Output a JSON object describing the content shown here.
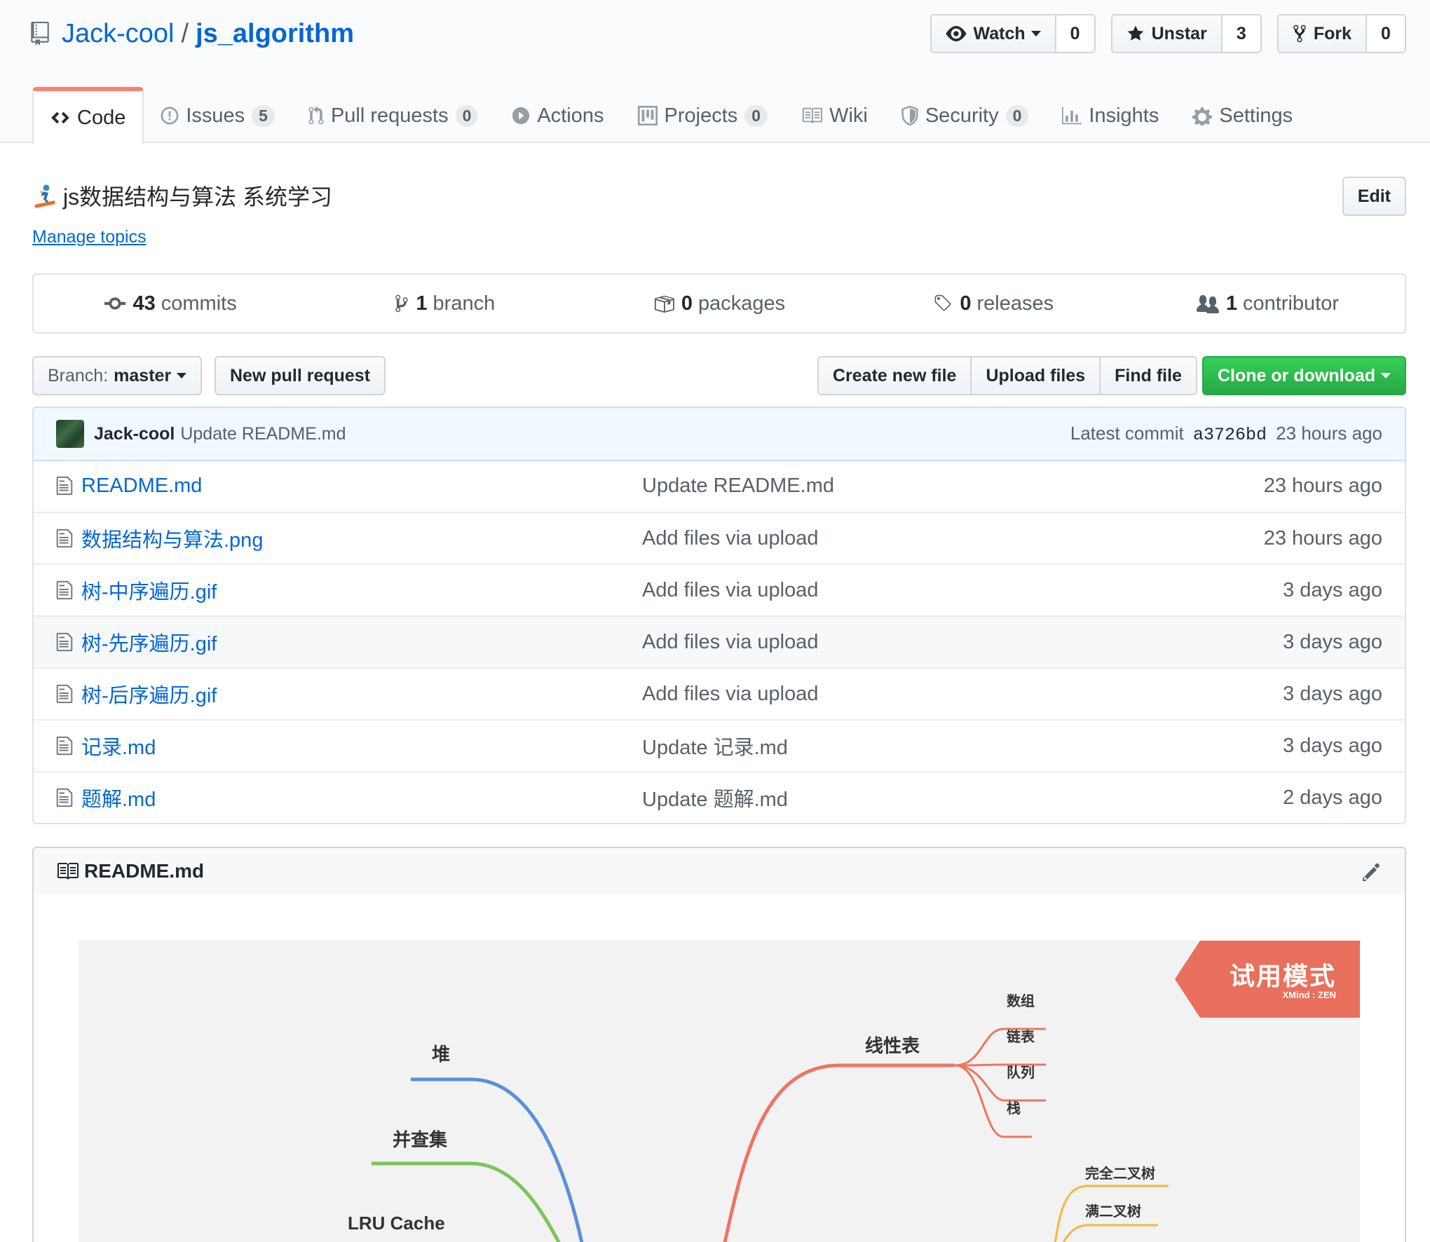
{
  "header": {
    "owner": "Jack-cool",
    "separator": "/",
    "repo": "js_algorithm",
    "watch": {
      "label": "Watch",
      "count": "0"
    },
    "star": {
      "label": "Unstar",
      "count": "3"
    },
    "fork": {
      "label": "Fork",
      "count": "0"
    }
  },
  "tabs": [
    {
      "label": "Code",
      "counter": ""
    },
    {
      "label": "Issues",
      "counter": "5"
    },
    {
      "label": "Pull requests",
      "counter": "0"
    },
    {
      "label": "Actions",
      "counter": ""
    },
    {
      "label": "Projects",
      "counter": "0"
    },
    {
      "label": "Wiki",
      "counter": ""
    },
    {
      "label": "Security",
      "counter": "0"
    },
    {
      "label": "Insights",
      "counter": ""
    },
    {
      "label": "Settings",
      "counter": ""
    }
  ],
  "description": {
    "text": "js数据结构与算法 系统学习",
    "manage_topics": "Manage topics",
    "edit": "Edit"
  },
  "summary": {
    "commits": {
      "count": "43",
      "label": "commits"
    },
    "branch": {
      "count": "1",
      "label": "branch"
    },
    "packages": {
      "count": "0",
      "label": "packages"
    },
    "releases": {
      "count": "0",
      "label": "releases"
    },
    "contributors": {
      "count": "1",
      "label": "contributor"
    }
  },
  "filenav": {
    "branch_prefix": "Branch:",
    "branch": "master",
    "new_pr": "New pull request",
    "create_file": "Create new file",
    "upload_files": "Upload files",
    "find_file": "Find file",
    "clone": "Clone or download"
  },
  "latest_commit": {
    "author": "Jack-cool",
    "message": "Update README.md",
    "prefix": "Latest commit",
    "sha": "a3726bd",
    "age": "23 hours ago"
  },
  "files": [
    {
      "name": "README.md",
      "message": "Update README.md",
      "age": "23 hours ago"
    },
    {
      "name": "数据结构与算法.png",
      "message": "Add files via upload",
      "age": "23 hours ago"
    },
    {
      "name": "树-中序遍历.gif",
      "message": "Add files via upload",
      "age": "3 days ago"
    },
    {
      "name": "树-先序遍历.gif",
      "message": "Add files via upload",
      "age": "3 days ago"
    },
    {
      "name": "树-后序遍历.gif",
      "message": "Add files via upload",
      "age": "3 days ago"
    },
    {
      "name": "记录.md",
      "message": "Update 记录.md",
      "age": "3 days ago"
    },
    {
      "name": "题解.md",
      "message": "Update 题解.md",
      "age": "2 days ago"
    }
  ],
  "readme": {
    "title": "README.md",
    "mindmap": {
      "trial": "试用模式",
      "trial_sub": "XMind : ZEN",
      "left_nodes": [
        "堆",
        "并查集",
        "LRU Cache"
      ],
      "linear": "线性表",
      "linear_children": [
        "数组",
        "链表",
        "队列",
        "栈"
      ],
      "tree_children": [
        "完全二叉树",
        "满二叉树"
      ]
    }
  },
  "colors": {
    "link": "#0366d6",
    "tab_accent": "#f9826c",
    "clone_green": "#28a745",
    "mindmap_heap": "#5b8fd9",
    "mindmap_unionfind": "#7cc45a",
    "mindmap_linear": "#ec7563",
    "mindmap_tree": "#f5b93b",
    "trial_badge": "#e8705c"
  }
}
